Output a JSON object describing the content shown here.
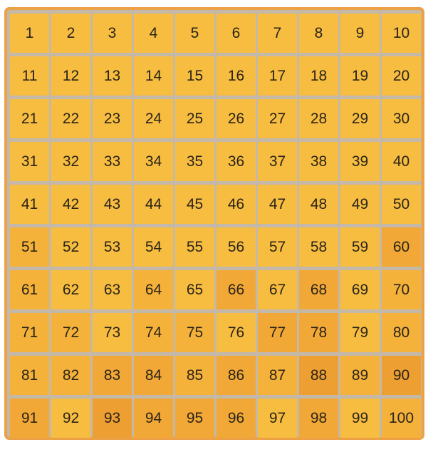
{
  "board": {
    "rows": 10,
    "cols": 10,
    "cells": [
      "1",
      "2",
      "3",
      "4",
      "5",
      "6",
      "7",
      "8",
      "9",
      "10",
      "11",
      "12",
      "13",
      "14",
      "15",
      "16",
      "17",
      "18",
      "19",
      "20",
      "21",
      "22",
      "23",
      "24",
      "25",
      "26",
      "27",
      "28",
      "29",
      "30",
      "31",
      "32",
      "33",
      "34",
      "35",
      "36",
      "37",
      "38",
      "39",
      "40",
      "41",
      "42",
      "43",
      "44",
      "45",
      "46",
      "47",
      "48",
      "49",
      "50",
      "51",
      "52",
      "53",
      "54",
      "55",
      "56",
      "57",
      "58",
      "59",
      "60",
      "61",
      "62",
      "63",
      "64",
      "65",
      "66",
      "67",
      "68",
      "69",
      "70",
      "71",
      "72",
      "73",
      "74",
      "75",
      "76",
      "77",
      "78",
      "79",
      "80",
      "81",
      "82",
      "83",
      "84",
      "85",
      "86",
      "87",
      "88",
      "89",
      "90",
      "91",
      "92",
      "93",
      "94",
      "95",
      "96",
      "97",
      "98",
      "99",
      "100"
    ],
    "shades": [
      0,
      0,
      0,
      0,
      0,
      0,
      0,
      0,
      0,
      0,
      0,
      0,
      0,
      0,
      0,
      0,
      0,
      0,
      0,
      0,
      0,
      0,
      0,
      0,
      0,
      0,
      0,
      0,
      0,
      0,
      0,
      0,
      0,
      0,
      0,
      0,
      0,
      0,
      0,
      0,
      0,
      0,
      0,
      0,
      0,
      0,
      0,
      0,
      0,
      0,
      1,
      0,
      0,
      0,
      0,
      0,
      0,
      0,
      0,
      2,
      1,
      0,
      0,
      1,
      0,
      2,
      0,
      2,
      0,
      1,
      1,
      1,
      0,
      1,
      1,
      0,
      2,
      2,
      0,
      1,
      1,
      1,
      2,
      2,
      1,
      2,
      1,
      3,
      1,
      3,
      2,
      0,
      3,
      2,
      2,
      2,
      0,
      2,
      0,
      1
    ],
    "palette": [
      "#f7bd40",
      "#f5b23a",
      "#f2a836",
      "#ee9f32"
    ],
    "border_color": "#eca146",
    "grid_line_color": "#c4b8a8"
  }
}
